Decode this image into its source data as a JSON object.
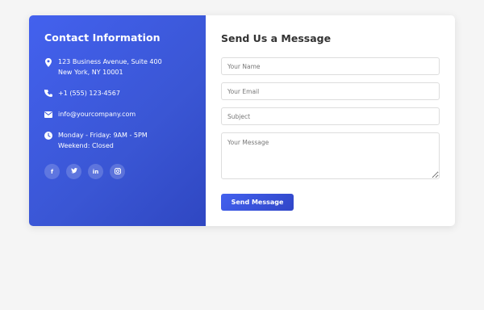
{
  "contact": {
    "title": "Contact Information",
    "address_line1": "123 Business Avenue, Suite 400",
    "address_line2": "New York, NY 10001",
    "phone": "+1 (555) 123-4567",
    "email": "info@yourcompany.com",
    "hours_line1": "Monday - Friday: 9AM - 5PM",
    "hours_line2": "Weekend: Closed",
    "socials": [
      {
        "icon": "facebook-icon",
        "glyph": "f"
      },
      {
        "icon": "twitter-icon",
        "glyph": "t"
      },
      {
        "icon": "linkedin-icon",
        "glyph": "in"
      },
      {
        "icon": "instagram-icon",
        "glyph": "◎"
      }
    ]
  },
  "form": {
    "title": "Send Us a Message",
    "name_placeholder": "Your Name",
    "email_placeholder": "Your Email",
    "subject_placeholder": "Subject",
    "message_placeholder": "Your Message",
    "submit_label": "Send Message"
  },
  "colors": {
    "accent": "#4361ee",
    "background": "#f5f5f5",
    "title_text": "#333333"
  }
}
